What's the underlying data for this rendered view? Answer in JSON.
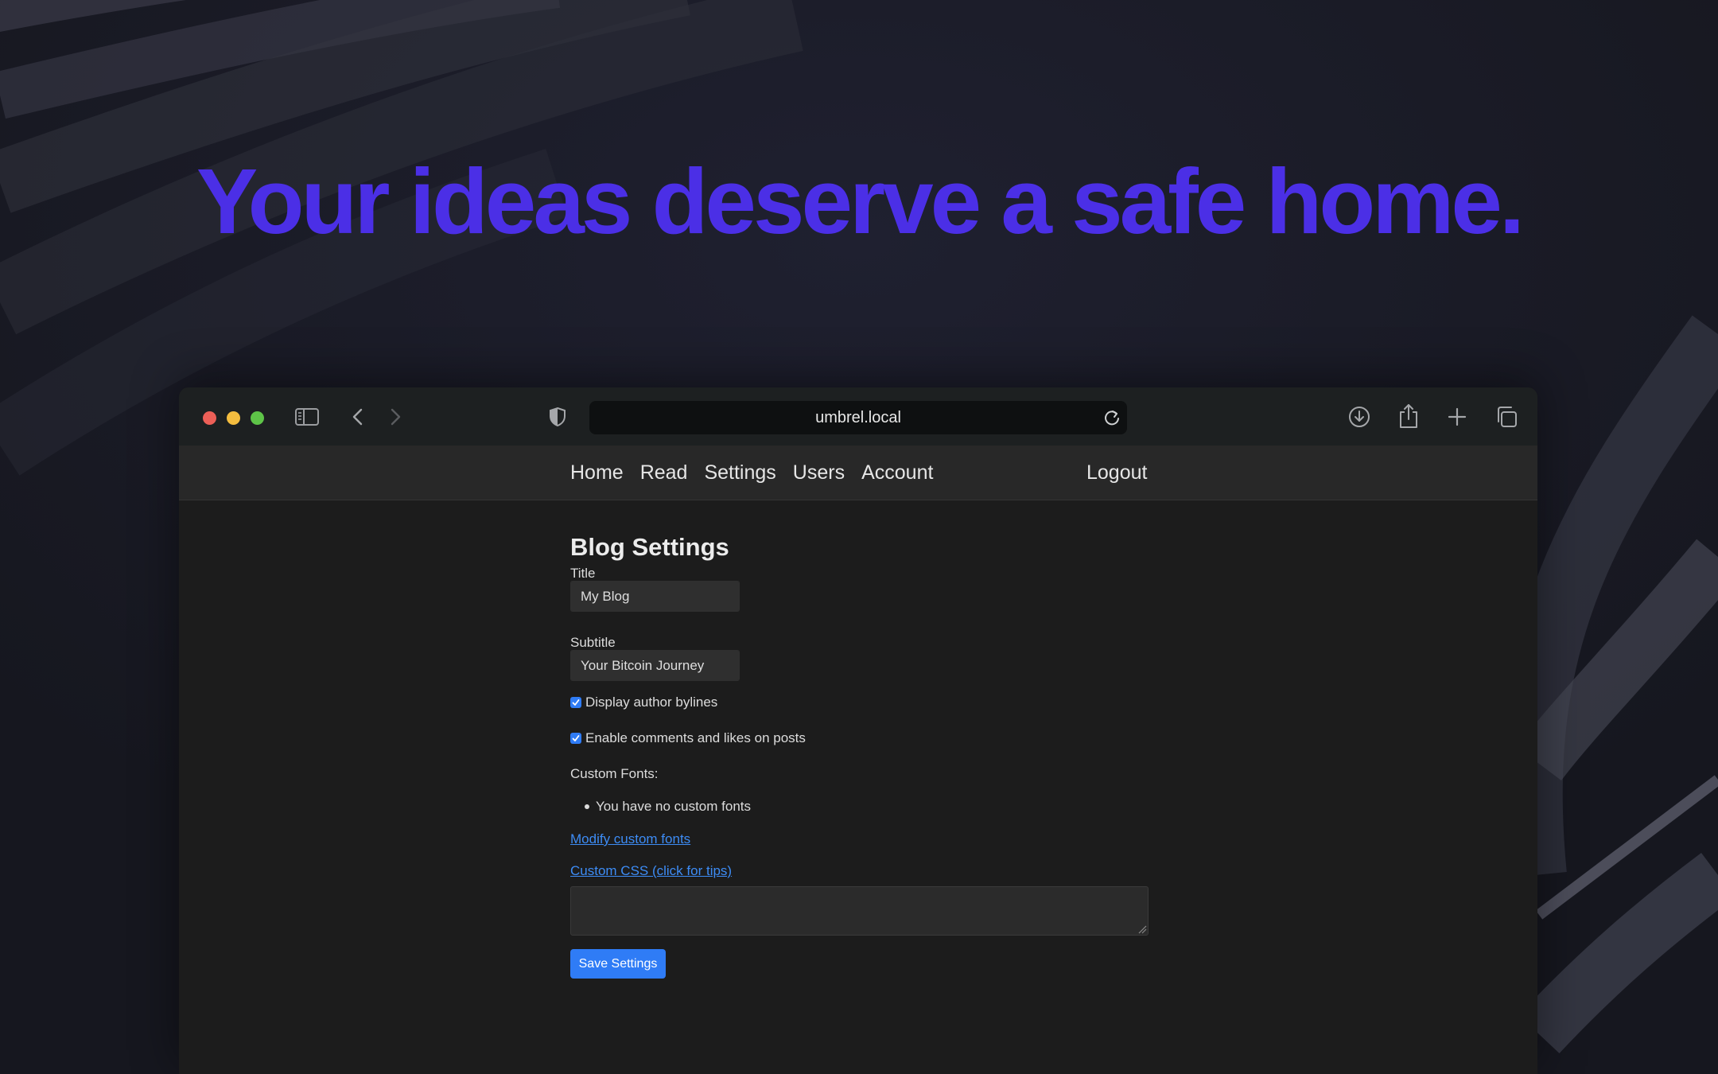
{
  "hero": {
    "headline": "Your ideas deserve a safe home."
  },
  "browser": {
    "url": "umbrel.local",
    "traffic_colors": [
      "#ec5f57",
      "#f4bd3f",
      "#5ec448"
    ],
    "toolbar_icons": [
      "sidebar-icon",
      "back-icon",
      "forward-icon",
      "shield-icon",
      "reload-icon",
      "download-icon",
      "share-icon",
      "new-tab-icon",
      "tabs-overview-icon"
    ]
  },
  "nav": {
    "links": [
      "Home",
      "Read",
      "Settings",
      "Users",
      "Account"
    ],
    "logout": "Logout"
  },
  "settings": {
    "title": "Blog Settings",
    "title_label": "Title",
    "title_value": "My Blog",
    "subtitle_label": "Subtitle",
    "subtitle_value": "Your Bitcoin Journey",
    "bylines_label": "Display author bylines",
    "bylines_checked": true,
    "comments_label": "Enable comments and likes on posts",
    "comments_checked": true,
    "custom_fonts_label": "Custom Fonts:",
    "no_fonts_item": "You have no custom fonts",
    "modify_fonts_link": "Modify custom fonts",
    "custom_css_link": "Custom CSS (click for tips)",
    "custom_css_value": "",
    "save_button": "Save Settings"
  },
  "colors": {
    "headline": "#4b2fe6",
    "accent": "#2f7cf6",
    "link": "#3d8cf5"
  }
}
